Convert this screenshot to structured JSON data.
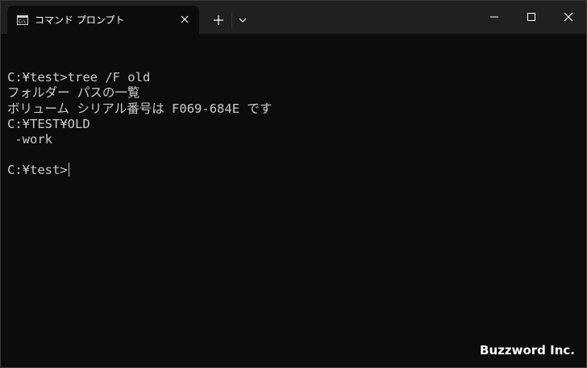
{
  "tab": {
    "title": "コマンド プロンプト",
    "icon": "command-prompt-icon"
  },
  "titlebar": {
    "new_tab_icon": "plus-icon",
    "dropdown_icon": "chevron-down-icon",
    "minimize_icon": "minimize-icon",
    "maximize_icon": "maximize-icon",
    "close_icon": "close-icon"
  },
  "console": {
    "lines": [
      "",
      "C:¥test>tree /F old",
      "フォルダー パスの一覧",
      "ボリューム シリアル番号は F069-684E です",
      "C:¥TEST¥OLD",
      " -work",
      "",
      "C:¥test>"
    ]
  },
  "watermark": "Buzzword Inc.",
  "colors": {
    "console_bg": "#0c0c0c",
    "titlebar_bg": "#202020",
    "text": "#cccccc"
  }
}
